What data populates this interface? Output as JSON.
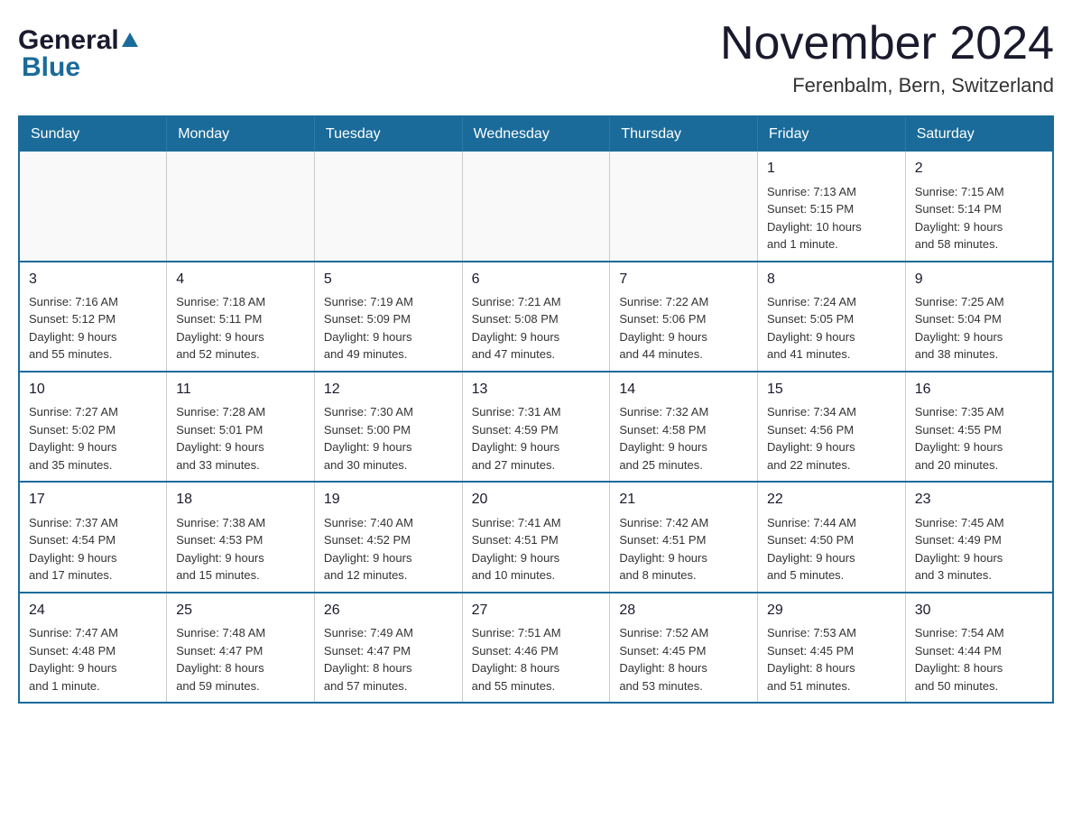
{
  "header": {
    "logo_general": "General",
    "logo_blue": "Blue",
    "month_title": "November 2024",
    "location": "Ferenbalm, Bern, Switzerland"
  },
  "weekdays": [
    "Sunday",
    "Monday",
    "Tuesday",
    "Wednesday",
    "Thursday",
    "Friday",
    "Saturday"
  ],
  "weeks": [
    [
      {
        "day": "",
        "info": ""
      },
      {
        "day": "",
        "info": ""
      },
      {
        "day": "",
        "info": ""
      },
      {
        "day": "",
        "info": ""
      },
      {
        "day": "",
        "info": ""
      },
      {
        "day": "1",
        "info": "Sunrise: 7:13 AM\nSunset: 5:15 PM\nDaylight: 10 hours\nand 1 minute."
      },
      {
        "day": "2",
        "info": "Sunrise: 7:15 AM\nSunset: 5:14 PM\nDaylight: 9 hours\nand 58 minutes."
      }
    ],
    [
      {
        "day": "3",
        "info": "Sunrise: 7:16 AM\nSunset: 5:12 PM\nDaylight: 9 hours\nand 55 minutes."
      },
      {
        "day": "4",
        "info": "Sunrise: 7:18 AM\nSunset: 5:11 PM\nDaylight: 9 hours\nand 52 minutes."
      },
      {
        "day": "5",
        "info": "Sunrise: 7:19 AM\nSunset: 5:09 PM\nDaylight: 9 hours\nand 49 minutes."
      },
      {
        "day": "6",
        "info": "Sunrise: 7:21 AM\nSunset: 5:08 PM\nDaylight: 9 hours\nand 47 minutes."
      },
      {
        "day": "7",
        "info": "Sunrise: 7:22 AM\nSunset: 5:06 PM\nDaylight: 9 hours\nand 44 minutes."
      },
      {
        "day": "8",
        "info": "Sunrise: 7:24 AM\nSunset: 5:05 PM\nDaylight: 9 hours\nand 41 minutes."
      },
      {
        "day": "9",
        "info": "Sunrise: 7:25 AM\nSunset: 5:04 PM\nDaylight: 9 hours\nand 38 minutes."
      }
    ],
    [
      {
        "day": "10",
        "info": "Sunrise: 7:27 AM\nSunset: 5:02 PM\nDaylight: 9 hours\nand 35 minutes."
      },
      {
        "day": "11",
        "info": "Sunrise: 7:28 AM\nSunset: 5:01 PM\nDaylight: 9 hours\nand 33 minutes."
      },
      {
        "day": "12",
        "info": "Sunrise: 7:30 AM\nSunset: 5:00 PM\nDaylight: 9 hours\nand 30 minutes."
      },
      {
        "day": "13",
        "info": "Sunrise: 7:31 AM\nSunset: 4:59 PM\nDaylight: 9 hours\nand 27 minutes."
      },
      {
        "day": "14",
        "info": "Sunrise: 7:32 AM\nSunset: 4:58 PM\nDaylight: 9 hours\nand 25 minutes."
      },
      {
        "day": "15",
        "info": "Sunrise: 7:34 AM\nSunset: 4:56 PM\nDaylight: 9 hours\nand 22 minutes."
      },
      {
        "day": "16",
        "info": "Sunrise: 7:35 AM\nSunset: 4:55 PM\nDaylight: 9 hours\nand 20 minutes."
      }
    ],
    [
      {
        "day": "17",
        "info": "Sunrise: 7:37 AM\nSunset: 4:54 PM\nDaylight: 9 hours\nand 17 minutes."
      },
      {
        "day": "18",
        "info": "Sunrise: 7:38 AM\nSunset: 4:53 PM\nDaylight: 9 hours\nand 15 minutes."
      },
      {
        "day": "19",
        "info": "Sunrise: 7:40 AM\nSunset: 4:52 PM\nDaylight: 9 hours\nand 12 minutes."
      },
      {
        "day": "20",
        "info": "Sunrise: 7:41 AM\nSunset: 4:51 PM\nDaylight: 9 hours\nand 10 minutes."
      },
      {
        "day": "21",
        "info": "Sunrise: 7:42 AM\nSunset: 4:51 PM\nDaylight: 9 hours\nand 8 minutes."
      },
      {
        "day": "22",
        "info": "Sunrise: 7:44 AM\nSunset: 4:50 PM\nDaylight: 9 hours\nand 5 minutes."
      },
      {
        "day": "23",
        "info": "Sunrise: 7:45 AM\nSunset: 4:49 PM\nDaylight: 9 hours\nand 3 minutes."
      }
    ],
    [
      {
        "day": "24",
        "info": "Sunrise: 7:47 AM\nSunset: 4:48 PM\nDaylight: 9 hours\nand 1 minute."
      },
      {
        "day": "25",
        "info": "Sunrise: 7:48 AM\nSunset: 4:47 PM\nDaylight: 8 hours\nand 59 minutes."
      },
      {
        "day": "26",
        "info": "Sunrise: 7:49 AM\nSunset: 4:47 PM\nDaylight: 8 hours\nand 57 minutes."
      },
      {
        "day": "27",
        "info": "Sunrise: 7:51 AM\nSunset: 4:46 PM\nDaylight: 8 hours\nand 55 minutes."
      },
      {
        "day": "28",
        "info": "Sunrise: 7:52 AM\nSunset: 4:45 PM\nDaylight: 8 hours\nand 53 minutes."
      },
      {
        "day": "29",
        "info": "Sunrise: 7:53 AM\nSunset: 4:45 PM\nDaylight: 8 hours\nand 51 minutes."
      },
      {
        "day": "30",
        "info": "Sunrise: 7:54 AM\nSunset: 4:44 PM\nDaylight: 8 hours\nand 50 minutes."
      }
    ]
  ]
}
